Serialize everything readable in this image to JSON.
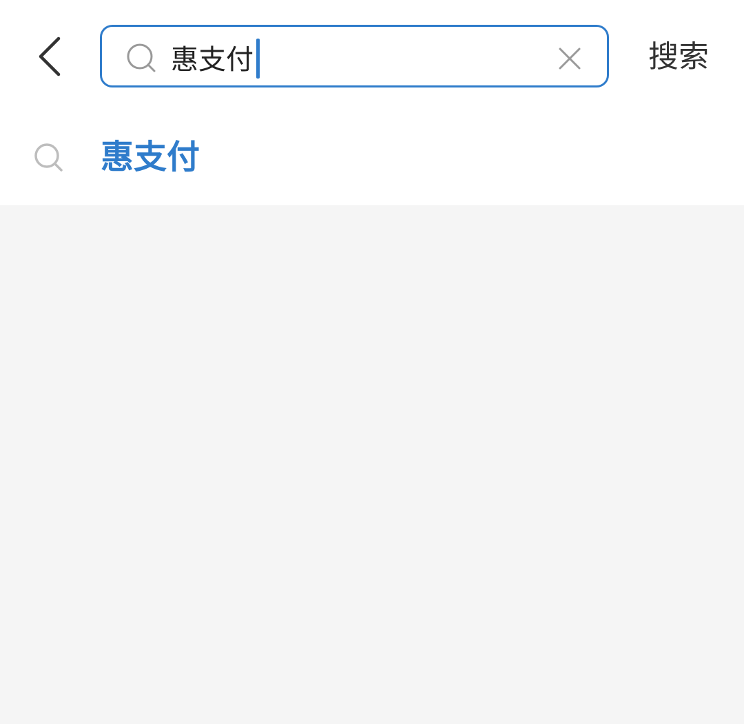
{
  "header": {
    "back_icon": "chevron-left-icon",
    "search": {
      "value": "惠支付",
      "placeholder": "",
      "search_icon": "search-icon",
      "clear_icon": "close-icon",
      "accent_color": "#2f7ccb"
    },
    "search_button_label": "搜索"
  },
  "suggestions": [
    {
      "label": "惠支付",
      "icon": "search-icon",
      "color": "#2f7ccb"
    }
  ],
  "colors": {
    "background": "#f5f5f5",
    "surface": "#ffffff",
    "text_primary": "#333333",
    "accent": "#2f7ccb"
  }
}
